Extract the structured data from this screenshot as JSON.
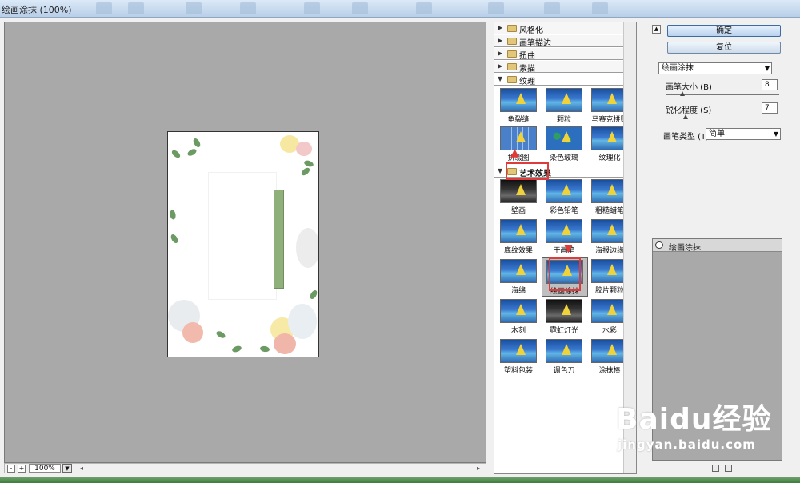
{
  "window": {
    "title": "绘画涂抹 (100%)"
  },
  "preview": {
    "zoom_value": "100%",
    "zoom_out": "-",
    "zoom_in": "+"
  },
  "gallery": {
    "categories": [
      {
        "label": "风格化"
      },
      {
        "label": "画笔描边"
      },
      {
        "label": "扭曲"
      },
      {
        "label": "素描"
      },
      {
        "label": "纹理"
      },
      {
        "label": "艺术效果"
      }
    ],
    "texture_filters": [
      "龟裂缝",
      "颗粒",
      "马赛克拼贴",
      "拼缀图",
      "染色玻璃",
      "纹理化"
    ],
    "artistic_filters": [
      "壁画",
      "彩色铅笔",
      "粗糙蜡笔",
      "底纹效果",
      "干画笔",
      "海报边缘",
      "海绵",
      "绘画涂抹",
      "胶片颗粒",
      "木刻",
      "霓虹灯光",
      "水彩",
      "塑料包装",
      "调色刀",
      "涂抹棒"
    ]
  },
  "controls": {
    "ok_label": "确定",
    "reset_label": "复位",
    "filter_select": "绘画涂抹",
    "brush_size_label": "画笔大小 (B)",
    "brush_size_value": "8",
    "sharpness_label": "锐化程度 (S)",
    "sharpness_value": "7",
    "brush_type_label": "画笔类型 (T):",
    "brush_type_value": "简单"
  },
  "layers": {
    "active_layer": "绘画涂抹"
  },
  "watermark": {
    "brand": "Baidu经验",
    "url": "jingyan.baidu.com"
  },
  "colors": {
    "highlight_red": "#e03b3b",
    "preview_bg": "#a9a9a9",
    "button_blue": "#b9d2ee"
  }
}
